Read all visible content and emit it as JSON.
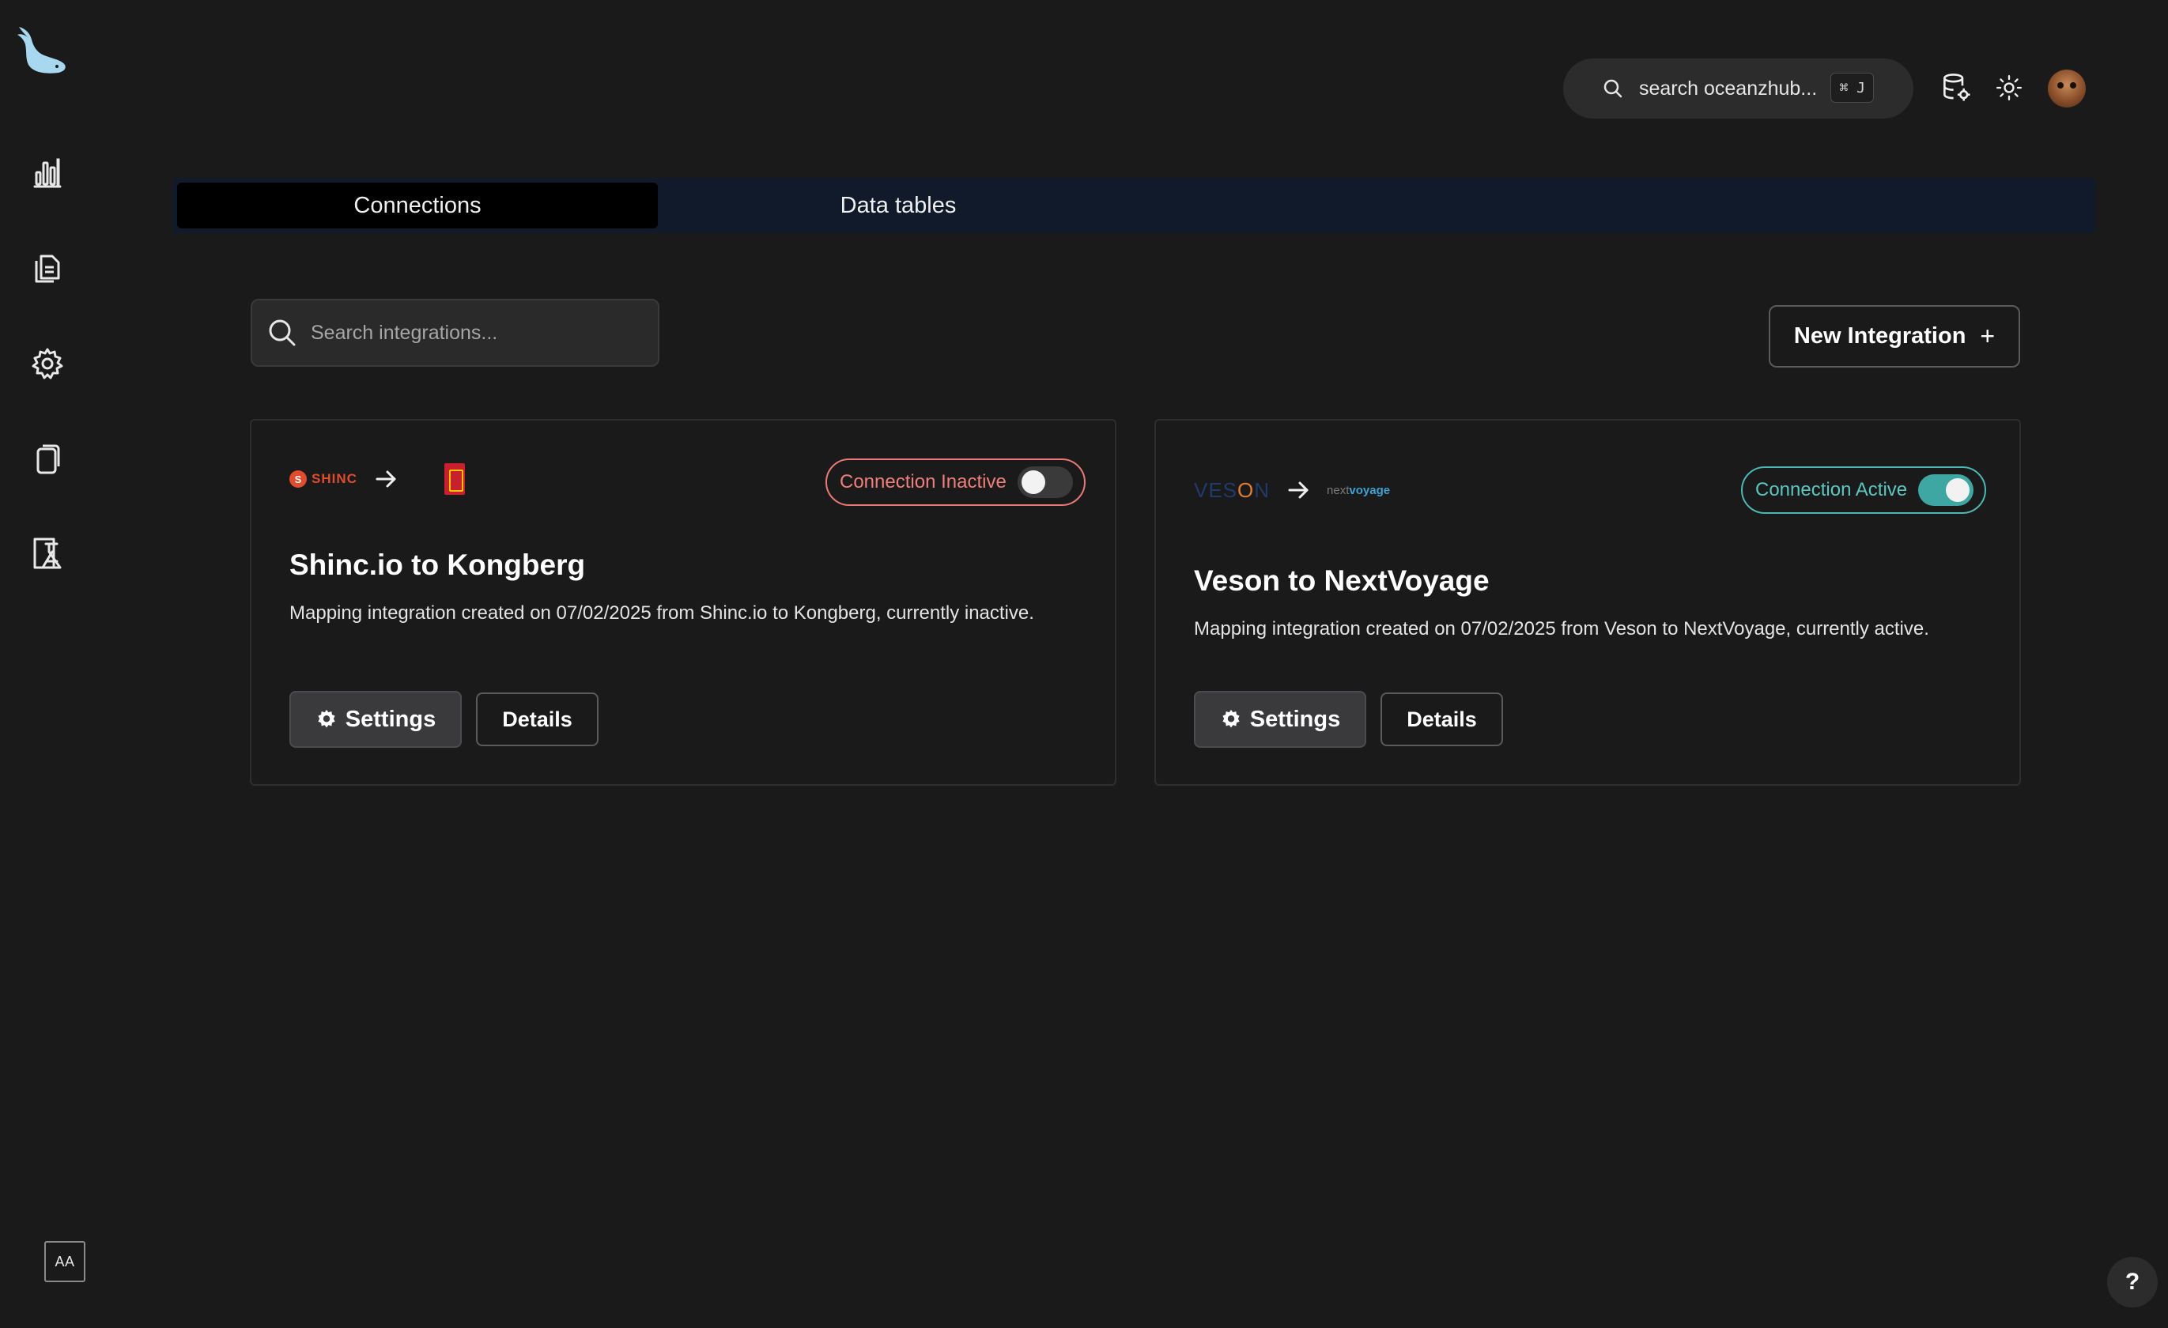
{
  "sidebar": {
    "items": [
      {
        "icon": "bar-chart-icon"
      },
      {
        "icon": "documents-icon"
      },
      {
        "icon": "gear-icon"
      },
      {
        "icon": "cards-icon"
      },
      {
        "icon": "lab-flask-icon"
      }
    ],
    "font_size_button": "AA"
  },
  "header": {
    "search_placeholder": "search oceanzhub...",
    "search_shortcut": "⌘ J"
  },
  "tabs": [
    {
      "label": "Connections",
      "active": true
    },
    {
      "label": "Data tables",
      "active": false
    }
  ],
  "toolbar": {
    "search_placeholder": "Search integrations...",
    "new_integration_label": "New Integration",
    "new_integration_icon": "+"
  },
  "cards": [
    {
      "source_logo": "SHINC",
      "title": "Shinc.io to Kongberg",
      "description": "Mapping integration created on 07/02/2025 from Shinc.io to Kongberg, currently inactive.",
      "status_label": "Connection Inactive",
      "active": false,
      "settings_label": "Settings",
      "details_label": "Details"
    },
    {
      "source_logo": "VESON",
      "target_logo_prefix": "next",
      "target_logo_main": "voyage",
      "title": "Veson to NextVoyage",
      "description": "Mapping integration created on 07/02/2025 from Veson to NextVoyage, currently active.",
      "status_label": "Connection Active",
      "active": true,
      "settings_label": "Settings",
      "details_label": "Details"
    }
  ],
  "help_label": "?",
  "colors": {
    "background": "#1a1a1a",
    "tab_bar": "#101a2b",
    "inactive": "#ef7f7a",
    "active": "#5cc7c0",
    "brand_blue": "#a8d8f0"
  }
}
